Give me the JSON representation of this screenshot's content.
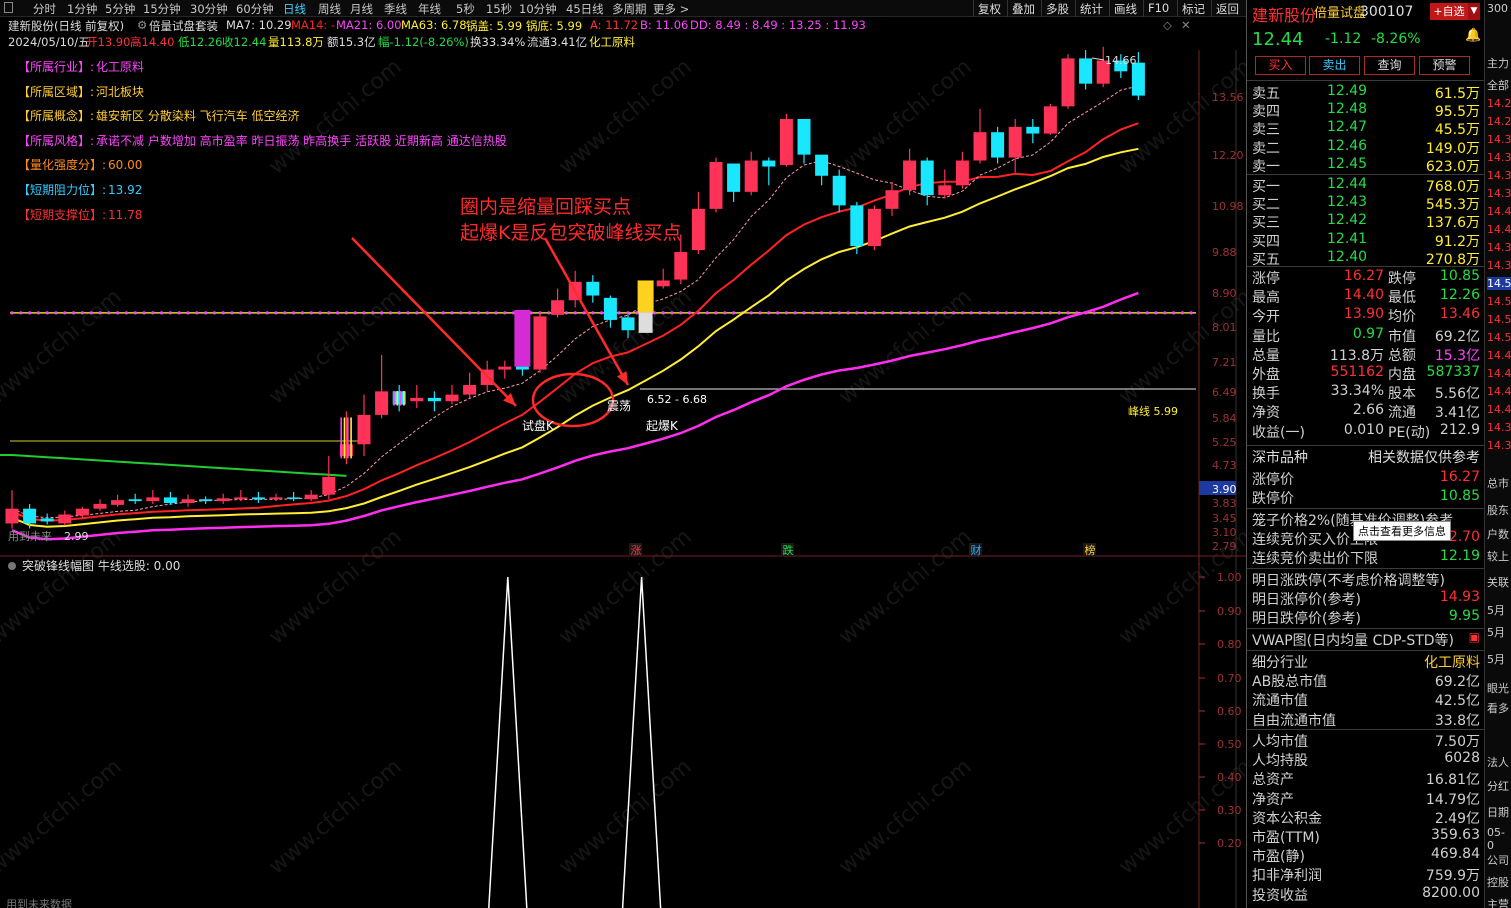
{
  "colors": {
    "up": "#ff3358",
    "down": "#19e6ff",
    "ma7": "#ff9bb0",
    "ma14": "#ff2222",
    "ma21": "#ffee33",
    "ma63": "#ff2ef0",
    "neck": "#d8d830",
    "annot": "#ff2a2a",
    "green": "#22dd44"
  },
  "menubar": {
    "items": [
      "分时",
      "1分钟",
      "5分钟",
      "15分钟",
      "30分钟",
      "60分钟",
      "日线",
      "周线",
      "月线",
      "季线",
      "年线",
      "5秒",
      "15秒",
      "10分钟",
      "45日线",
      "多周期",
      "更多 >"
    ],
    "active_index": 6,
    "right_buttons": [
      "复权",
      "叠加",
      "多股",
      "统计",
      "画线",
      "F10",
      "标记",
      "返回"
    ]
  },
  "info_line1": {
    "name": "建新股份(日线 前复权)",
    "indicator": "倍量试盘套装",
    "ma7": "MA7: 10.29",
    "ma14": "MA14: -",
    "ma21": "MA21: 6.00",
    "ma63": "MA63: 6.78",
    "guogai": "锅盖: 5.99",
    "guodi": "锅底: 5.99",
    "a": "A: 11.72",
    "b": "B: 11.06",
    "dd": "DD: 8.49 : 8.49 : 13.25 : 11.93"
  },
  "info_line2": {
    "date": "2024/05/10/五",
    "open": "开13.90",
    "high": "高14.40",
    "low": "低12.26",
    "close": "收12.44",
    "vol": "量113.8万",
    "amount": "额15.3亿",
    "change": "幅-1.12(-8.26%)",
    "turnover": "换33.34%",
    "float": "流通3.41亿",
    "industry": "化工原料"
  },
  "tags": [
    {
      "label": "【所属行业】:",
      "value": "化工原料",
      "lc": "#ff44ff",
      "vc": "#ff44ff"
    },
    {
      "label": "【所属区域】:",
      "value": "河北板块",
      "lc": "#ffcc33",
      "vc": "#ffcc33"
    },
    {
      "label": "【所属概念】:",
      "value": "雄安新区 分散染料 飞行汽车 低空经济",
      "lc": "#ffcc33",
      "vc": "#ffcc33"
    },
    {
      "label": "【所属风格】:",
      "value": "承诺不减 户数增加 高市盈率 昨日振荡 昨高换手 活跃股 近期新高 通达信热股",
      "lc": "#ff44ff",
      "vc": "#ff44ff"
    },
    {
      "label": "【量化强度分】:",
      "value": "60.00",
      "lc": "#ff8c1a",
      "vc": "#ff8c1a"
    },
    {
      "label": "【短期阻力位】:",
      "value": "13.92",
      "lc": "#33ccff",
      "vc": "#33ccff"
    },
    {
      "label": "【短期支撑位】:",
      "value": "11.78",
      "lc": "#ff3030",
      "vc": "#ff3030"
    }
  ],
  "annotation": {
    "line1": "圈内是缩量回踩买点",
    "line2": "起爆K是反包突破峰线买点"
  },
  "chart_labels": {
    "high_mark": "14.66",
    "low_mark": "2.99",
    "shiban": "试盘K",
    "qibao": "起爆K",
    "zhendang": "震荡",
    "range": "6.52 - 6.68",
    "fengxian": "峰线 5.99",
    "current_price": "3.90",
    "future_note": "用到未来",
    "future_data": "用到未来数据",
    "sub_title": "突破锋线幅图  牛线选股: 0.00",
    "tip": "点击查看更多信息",
    "markers": [
      "涨",
      "跌",
      "财",
      "榜"
    ]
  },
  "price_axis": [
    "13.56",
    "12.20",
    "10.98",
    "9.88",
    "8.90",
    "8.01",
    "7.21",
    "6.49",
    "5.84",
    "5.25",
    "4.73",
    "3.90",
    "3.83",
    "3.45",
    "3.10",
    "2.79"
  ],
  "sub_axis": [
    "1.00",
    "0.90",
    "0.80",
    "0.70",
    "0.60",
    "0.50",
    "0.40",
    "0.30",
    "0.20"
  ],
  "chart_data": {
    "type": "candlestick",
    "title": "建新股份(日线 前复权)",
    "candles": [
      [
        2.95,
        3.1,
        3.3,
        2.9
      ],
      [
        3.1,
        2.95,
        3.15,
        2.9
      ],
      [
        3.0,
        2.97,
        3.05,
        2.94
      ],
      [
        2.95,
        3.04,
        3.08,
        2.93
      ],
      [
        3.03,
        3.1,
        3.12,
        3.0
      ],
      [
        3.1,
        3.15,
        3.2,
        3.08
      ],
      [
        3.14,
        3.19,
        3.25,
        3.12
      ],
      [
        3.2,
        3.18,
        3.26,
        3.15
      ],
      [
        3.18,
        3.22,
        3.3,
        3.15
      ],
      [
        3.22,
        3.16,
        3.28,
        3.14
      ],
      [
        3.16,
        3.2,
        3.25,
        3.12
      ],
      [
        3.2,
        3.18,
        3.23,
        3.15
      ],
      [
        3.18,
        3.21,
        3.26,
        3.15
      ],
      [
        3.2,
        3.22,
        3.3,
        3.18
      ],
      [
        3.22,
        3.2,
        3.28,
        3.16
      ],
      [
        3.2,
        3.22,
        3.26,
        3.18
      ],
      [
        3.22,
        3.21,
        3.28,
        3.18
      ],
      [
        3.2,
        3.25,
        3.3,
        3.18
      ],
      [
        3.25,
        3.45,
        3.7,
        3.2
      ],
      [
        3.7,
        3.85,
        4.3,
        3.6
      ],
      [
        3.85,
        4.25,
        4.55,
        3.7
      ],
      [
        4.25,
        4.6,
        5.2,
        4.2
      ],
      [
        4.6,
        4.4,
        4.7,
        4.3
      ],
      [
        4.45,
        4.5,
        4.7,
        4.35
      ],
      [
        4.5,
        4.45,
        4.6,
        4.3
      ],
      [
        4.45,
        4.55,
        4.7,
        4.4
      ],
      [
        4.55,
        4.7,
        4.9,
        4.5
      ],
      [
        4.7,
        4.95,
        5.1,
        4.6
      ],
      [
        4.95,
        5.0,
        5.1,
        4.8
      ],
      [
        5.0,
        4.95,
        5.25,
        4.85
      ],
      [
        4.95,
        5.92,
        6.0,
        4.9
      ],
      [
        5.95,
        6.25,
        6.5,
        5.9
      ],
      [
        6.25,
        6.65,
        6.9,
        6.1
      ],
      [
        6.65,
        6.35,
        6.8,
        6.2
      ],
      [
        6.3,
        5.85,
        6.35,
        5.7
      ],
      [
        5.9,
        5.65,
        5.95,
        5.5
      ],
      [
        5.65,
        6.52,
        6.68,
        5.6
      ],
      [
        6.55,
        6.68,
        6.95,
        6.5
      ],
      [
        6.7,
        7.35,
        7.8,
        6.6
      ],
      [
        7.4,
        8.5,
        9.0,
        7.3
      ],
      [
        8.5,
        9.95,
        10.1,
        8.4
      ],
      [
        9.9,
        9.0,
        9.9,
        8.7
      ],
      [
        9.0,
        10.0,
        10.3,
        8.9
      ],
      [
        10.0,
        9.8,
        10.1,
        9.2
      ],
      [
        9.85,
        11.5,
        11.7,
        9.8
      ],
      [
        11.5,
        10.2,
        11.5,
        9.9
      ],
      [
        10.2,
        9.5,
        10.1,
        9.2
      ],
      [
        9.5,
        8.6,
        9.7,
        8.4
      ],
      [
        8.6,
        7.5,
        8.7,
        7.3
      ],
      [
        7.5,
        8.5,
        8.6,
        7.4
      ],
      [
        8.5,
        9.05,
        9.3,
        8.3
      ],
      [
        9.05,
        10.0,
        10.4,
        8.9
      ],
      [
        10.0,
        8.9,
        10.1,
        8.6
      ],
      [
        8.9,
        9.2,
        9.7,
        8.8
      ],
      [
        9.2,
        10.0,
        10.3,
        9.1
      ],
      [
        10.0,
        11.0,
        11.9,
        9.9
      ],
      [
        11.0,
        10.1,
        11.2,
        9.9
      ],
      [
        10.1,
        11.2,
        11.5,
        9.6
      ],
      [
        11.2,
        10.95,
        11.5,
        10.6
      ],
      [
        10.95,
        12.0,
        12.1,
        10.9
      ],
      [
        12.0,
        14.1,
        14.3,
        11.9
      ],
      [
        14.1,
        12.95,
        14.5,
        12.7
      ],
      [
        12.95,
        14.0,
        14.66,
        12.8
      ],
      [
        14.0,
        13.5,
        14.3,
        13.2
      ],
      [
        13.9,
        12.44,
        14.4,
        12.26
      ]
    ],
    "ma_lines": {
      "MA7": "dotted",
      "MA14": "red",
      "MA21": "yellow",
      "MA63": "magenta"
    },
    "peak_line": 5.99,
    "ylim": [
      2.79,
      15.0
    ],
    "sub_signal_bars": [
      28,
      36
    ]
  },
  "right_panel": {
    "stock_name": "建新股份",
    "indicator_tag": "倍量试盘",
    "code": "300107",
    "add_btn": "+自选",
    "price": "12.44",
    "change": "-1.12",
    "pct": "-8.26%",
    "buttons": [
      "买入",
      "卖出",
      "查询",
      "预警"
    ],
    "asks": [
      {
        "l": "卖五",
        "p": "12.49",
        "v": "61.5万"
      },
      {
        "l": "卖四",
        "p": "12.48",
        "v": "95.5万"
      },
      {
        "l": "卖三",
        "p": "12.47",
        "v": "45.5万"
      },
      {
        "l": "卖二",
        "p": "12.46",
        "v": "149.0万"
      },
      {
        "l": "卖一",
        "p": "12.45",
        "v": "623.0万"
      }
    ],
    "bids": [
      {
        "l": "买一",
        "p": "12.44",
        "v": "768.0万"
      },
      {
        "l": "买二",
        "p": "12.43",
        "v": "545.3万"
      },
      {
        "l": "买三",
        "p": "12.42",
        "v": "137.6万"
      },
      {
        "l": "买四",
        "p": "12.41",
        "v": "91.2万"
      },
      {
        "l": "买五",
        "p": "12.40",
        "v": "270.8万"
      }
    ],
    "stats": [
      {
        "l1": "涨停",
        "v1": "16.27",
        "c1": "#ff3030",
        "l2": "跌停",
        "v2": "10.85",
        "c2": "#22dd44"
      },
      {
        "l1": "最高",
        "v1": "14.40",
        "c1": "#ff3030",
        "l2": "最低",
        "v2": "12.26",
        "c2": "#22dd44"
      },
      {
        "l1": "今开",
        "v1": "13.90",
        "c1": "#ff3030",
        "l2": "均价",
        "v2": "13.46",
        "c2": "#ff3030"
      },
      {
        "l1": "量比",
        "v1": "0.97",
        "c1": "#22dd44",
        "l2": "市值",
        "v2": "69.2亿",
        "c2": "#d0d0d0"
      },
      {
        "l1": "总量",
        "v1": "113.8万",
        "c1": "#d0d0d0",
        "l2": "总额",
        "v2": "15.3亿",
        "c2": "#ff44ff"
      },
      {
        "l1": "外盘",
        "v1": "551162",
        "c1": "#ff3030",
        "l2": "内盘",
        "v2": "587337",
        "c2": "#22dd44"
      },
      {
        "l1": "换手",
        "v1": "33.34%",
        "c1": "#d0d0d0",
        "l2": "股本",
        "v2": "5.56亿",
        "c2": "#d0d0d0"
      },
      {
        "l1": "净资",
        "v1": "2.66",
        "c1": "#d0d0d0",
        "l2": "流通",
        "v2": "3.41亿",
        "c2": "#d0d0d0"
      },
      {
        "l1": "收益(一)",
        "v1": "0.010",
        "c1": "#d0d0d0",
        "l2": "PE(动)",
        "v2": "212.9",
        "c2": "#d0d0d0"
      }
    ],
    "section_market": {
      "title": "深市品种",
      "note": "相关数据仅供参考"
    },
    "limit_rows": [
      {
        "l": "涨停价",
        "v": "16.27",
        "c": "#ff3030"
      },
      {
        "l": "跌停价",
        "v": "10.85",
        "c": "#22dd44"
      }
    ],
    "cage_rows": [
      {
        "l": "笼子价格2%(随基准价调整)参考",
        "v": "",
        "c": "#d0d0d0"
      },
      {
        "l": "连续竞价买入价上限",
        "v": "12.70",
        "c": "#ff3030"
      },
      {
        "l": "连续竞价卖出价下限",
        "v": "12.19",
        "c": "#22dd44"
      }
    ],
    "next_rows": [
      {
        "l": "明日涨跌停(不考虑价格调整等)",
        "v": "",
        "c": "#d0d0d0"
      },
      {
        "l": "明日涨停价(参考)",
        "v": "14.93",
        "c": "#ff3030"
      },
      {
        "l": "明日跌停价(参考)",
        "v": "9.95",
        "c": "#22dd44"
      }
    ],
    "vwap": "VWAP图(日内均量 CDP-STD等)",
    "detail_rows": [
      {
        "l": "细分行业",
        "v": "化工原料",
        "c": "#ffcc33"
      },
      {
        "l": "AB股总市值",
        "v": "69.2亿",
        "c": "#d0d0d0"
      },
      {
        "l": "流通市值",
        "v": "42.5亿",
        "c": "#d0d0d0"
      },
      {
        "l": "自由流通市值",
        "v": "33.8亿",
        "c": "#d0d0d0"
      }
    ],
    "fin_rows": [
      {
        "l": "人均市值",
        "v": "7.50万",
        "c": "#d0d0d0"
      },
      {
        "l": "人均持股",
        "v": "6028",
        "c": "#d0d0d0"
      },
      {
        "l": "总资产",
        "v": "16.81亿",
        "c": "#d0d0d0"
      },
      {
        "l": "净资产",
        "v": "14.79亿",
        "c": "#d0d0d0"
      },
      {
        "l": "资本公积金",
        "v": "2.49亿",
        "c": "#d0d0d0"
      },
      {
        "l": "市盈(TTM)",
        "v": "359.63",
        "c": "#d0d0d0"
      },
      {
        "l": "市盈(静)",
        "v": "469.84",
        "c": "#d0d0d0"
      },
      {
        "l": "扣非净利润",
        "v": "759.9万",
        "c": "#d0d0d0"
      },
      {
        "l": "投资收益",
        "v": "8200.00",
        "c": "#d0d0d0"
      }
    ]
  },
  "far_right": {
    "items": [
      "300",
      "主力",
      "全部",
      "14.2",
      "14.2",
      "14.3",
      "14.3",
      "14.3",
      "14.3",
      "14.4",
      "14.4",
      "14.3",
      "14.3",
      "14.5",
      "14.5",
      "14.5",
      "14.5",
      "14.4",
      "14.4",
      "14.4",
      "14.4",
      "14.3",
      "14.3",
      "总市",
      "股东",
      "户数",
      "较上",
      "关联",
      "5月",
      "5月",
      "5月",
      "眼光",
      "看多",
      "法人",
      "分红",
      "日期",
      "05-0",
      "公司",
      "控股",
      "主营"
    ]
  }
}
